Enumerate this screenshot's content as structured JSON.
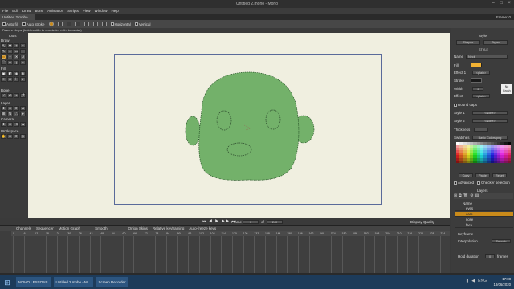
{
  "window": {
    "title": "Untitled 2.moho - Moho",
    "frame_label": "Frame: 0"
  },
  "menu": [
    "File",
    "Edit",
    "Draw",
    "Bone",
    "Animation",
    "Scripts",
    "View",
    "Window",
    "Help"
  ],
  "doc_tab": "Untitled 2.moho",
  "tool_options": {
    "auto_fill": "Auto fill",
    "auto_stroke": "Auto stroke",
    "horizontal": "Horizontal",
    "vertical": "Vertical"
  },
  "hint": "Draw a shape (hold <shift> to constrain, <alt> to center)",
  "tools": {
    "title": "Tools",
    "draw": "Draw",
    "fill": "Fill",
    "bone": "Bone",
    "layer": "Layer",
    "camera": "Camera",
    "workspace": "Workspace"
  },
  "timeline": {
    "frame_label": "Frame",
    "frame_value": "0",
    "of_label": "of",
    "end_value": "240",
    "display_quality": "Display Quality",
    "tabs": [
      "Channels",
      "Sequencer",
      "Motion Graph"
    ],
    "smooth": "Smooth",
    "onion": "Onion Skins",
    "relative": "Relative keyframing",
    "auto_freeze": "Auto-freeze keys",
    "ticks": [
      "0",
      "6",
      "12",
      "18",
      "24",
      "30",
      "36",
      "42",
      "48",
      "54",
      "60",
      "66",
      "72",
      "78",
      "84",
      "90",
      "96",
      "102",
      "108",
      "114",
      "120",
      "126",
      "132",
      "138",
      "144",
      "150",
      "156",
      "162",
      "168",
      "174",
      "180",
      "186",
      "192",
      "198",
      "204",
      "210",
      "216",
      "222",
      "228",
      "234"
    ]
  },
  "style_panel": {
    "header": "Style",
    "tab_shapes": "Shapes",
    "tab_styles": "Styles",
    "style_label": "STYLE",
    "name_label": "Name",
    "name_value": "Neck",
    "fill_label": "Fill",
    "effect1_label": "Effect 1",
    "effect1_value": "<plain>",
    "stroke_label": "Stroke",
    "no_brush": "No Brush",
    "width_label": "Width",
    "width_value": "1",
    "effect_label": "Effect",
    "effect_value": "<plain>",
    "round_caps": "Round caps",
    "style1_label": "Style 1",
    "style1_value": "<None>",
    "style2_label": "Style 2",
    "style2_value": "<None>",
    "thickness_label": "Thickness",
    "swatches_label": "Swatches",
    "swatches_value": "Basic Colors.png",
    "copy": "Copy",
    "paste": "Paste",
    "reset": "Reset",
    "advanced": "Advanced",
    "checker": "Checker selection",
    "fill_color": "#f2b233",
    "stroke_color": "#1a1a1a"
  },
  "layers_panel": {
    "header": "Layers",
    "col_name": "Name",
    "items": [
      {
        "name": "eyes",
        "selected": false
      },
      {
        "name": "ears",
        "selected": true
      },
      {
        "name": "nose",
        "selected": false
      },
      {
        "name": "face",
        "selected": false
      }
    ]
  },
  "keyframe_panel": {
    "header": "Keyframe",
    "interp_label": "Interpolation",
    "interp_value": "Smooth",
    "hold_label": "Hold duration",
    "hold_value": "0",
    "frames": "frames"
  },
  "taskbar": {
    "items": [
      "MOHO LESSONS",
      "Untitled 2.moho - M...",
      "Screen Recorder"
    ],
    "lang": "ENG",
    "time": "17:08",
    "date": "18/06/2020"
  },
  "colors": {
    "face_fill": "#73b16a",
    "canvas": "#f0efe0",
    "selection": "#c98a1a"
  }
}
